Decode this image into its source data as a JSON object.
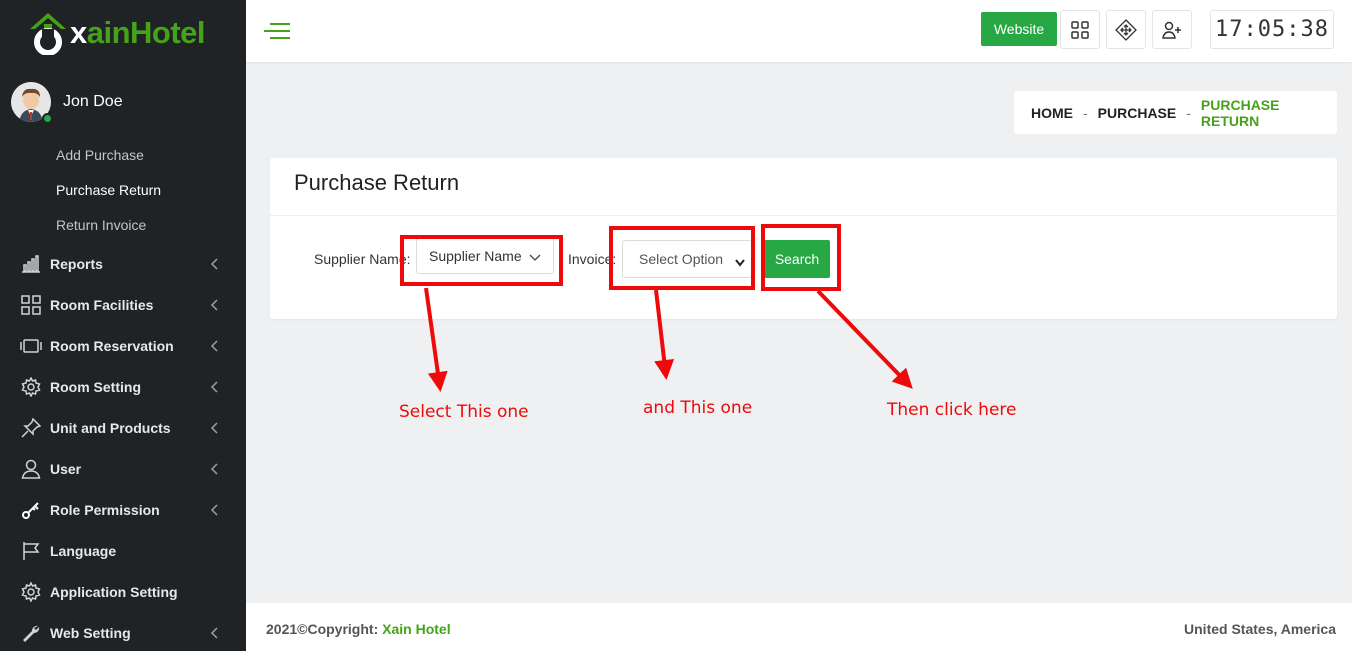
{
  "app": {
    "logo_left": "x",
    "logo_right": "ainHotel",
    "user_name": "Jon Doe"
  },
  "sidebar": {
    "subitems": [
      {
        "label": "Add Purchase"
      },
      {
        "label": "Purchase Return"
      },
      {
        "label": "Return Invoice"
      }
    ],
    "items": [
      {
        "label": "Reports",
        "icon": "bar-chart-icon"
      },
      {
        "label": "Room Facilities",
        "icon": "grid-icon"
      },
      {
        "label": "Room Reservation",
        "icon": "film-icon"
      },
      {
        "label": "Room Setting",
        "icon": "gear-icon"
      },
      {
        "label": "Unit and Products",
        "icon": "pin-icon"
      },
      {
        "label": "User",
        "icon": "user-icon"
      },
      {
        "label": "Role Permission",
        "icon": "key-icon"
      },
      {
        "label": "Language",
        "icon": "flag-icon"
      },
      {
        "label": "Application Setting",
        "icon": "gear-icon"
      },
      {
        "label": "Web Setting",
        "icon": "wrench-icon"
      }
    ]
  },
  "topbar": {
    "website_label": "Website",
    "clock": "17:05:38"
  },
  "breadcrumb": {
    "home": "HOME",
    "sep": "-",
    "purchase": "PURCHASE",
    "current": "PURCHASE RETURN"
  },
  "card": {
    "title": "Purchase Return",
    "supplier_label": "Supplier Name:",
    "supplier_value": "Supplier Name",
    "invoice_label": "Invoice:",
    "invoice_value": "Select Option",
    "search_label": "Search"
  },
  "footer": {
    "copyright": "2021©Copyright: ",
    "brand": "Xain Hotel",
    "location": "United States, America"
  },
  "annotations": {
    "select_supplier": "Select This one",
    "select_invoice": "and This one",
    "click_search": "Then click here"
  },
  "colors": {
    "brand_green": "#46a317",
    "button_green": "#28a745",
    "sidebar_bg": "#1f2326",
    "annotation_red": "#ee0a0a"
  }
}
